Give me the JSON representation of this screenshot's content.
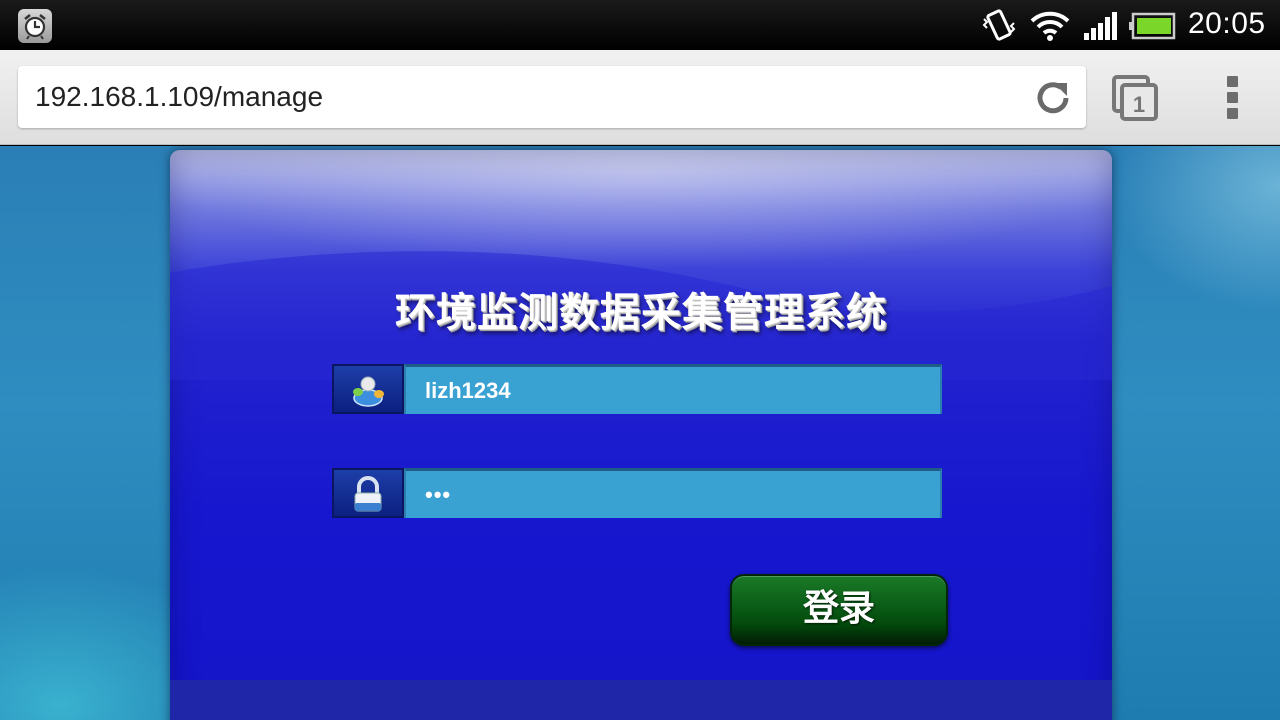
{
  "status_bar": {
    "time": "20:05",
    "icons": [
      "alarm-icon",
      "vibrate-icon",
      "wifi-icon",
      "signal-icon",
      "battery-icon"
    ]
  },
  "browser": {
    "url": "192.168.1.109/manage",
    "open_tabs_count": "1",
    "icons": [
      "reload-icon",
      "tabs-icon",
      "overflow-menu-icon"
    ]
  },
  "login": {
    "title": "环境监测数据采集管理系统",
    "username": {
      "value": "lizh1234",
      "icon": "user-icon"
    },
    "password": {
      "value": "•••",
      "icon": "lock-icon"
    },
    "submit_label": "登录"
  },
  "colors": {
    "page_background": "#2f8dc0",
    "panel_blue": "#1717cf",
    "input_fill": "#3aa2d2",
    "button_green": "#0a5c16"
  }
}
